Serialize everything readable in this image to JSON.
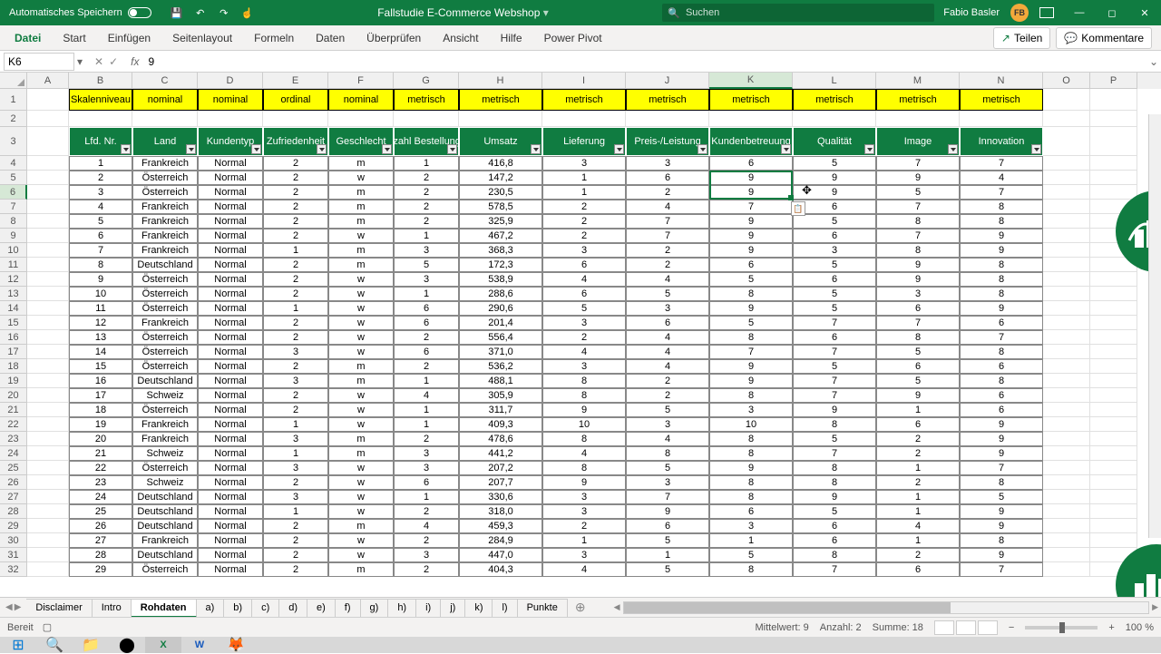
{
  "titlebar": {
    "autosave": "Automatisches Speichern",
    "filename": "Fallstudie E-Commerce Webshop",
    "search_placeholder": "Suchen",
    "username": "Fabio Basler",
    "user_initials": "FB"
  },
  "ribbon": {
    "tabs": [
      "Datei",
      "Start",
      "Einfügen",
      "Seitenlayout",
      "Formeln",
      "Daten",
      "Überprüfen",
      "Ansicht",
      "Hilfe",
      "Power Pivot"
    ],
    "share": "Teilen",
    "comments": "Kommentare"
  },
  "formula": {
    "namebox": "K6",
    "value": "9"
  },
  "columns": {
    "letters": [
      "A",
      "B",
      "C",
      "D",
      "E",
      "F",
      "G",
      "H",
      "I",
      "J",
      "K",
      "L",
      "M",
      "N",
      "O",
      "P"
    ],
    "widths": [
      46,
      70,
      72,
      72,
      72,
      72,
      72,
      92,
      92,
      92,
      92,
      92,
      92,
      92,
      52,
      52
    ],
    "selected_index": 10
  },
  "row1": {
    "label": "Skalenniveau",
    "values": [
      "nominal",
      "nominal",
      "ordinal",
      "nominal",
      "metrisch",
      "metrisch",
      "metrisch",
      "metrisch",
      "metrisch",
      "metrisch",
      "metrisch",
      "metrisch"
    ]
  },
  "table": {
    "headers": [
      "Lfd. Nr.",
      "Land",
      "Kundentyp",
      "Zufriedenheit",
      "Geschlecht",
      "Anzahl Bestellungen",
      "Umsatz",
      "Lieferung",
      "Preis-/Leistung",
      "Kundenbetreuung",
      "Qualität",
      "Image",
      "Innovation"
    ],
    "rows": [
      [
        1,
        "Frankreich",
        "Normal",
        2,
        "m",
        1,
        "416,8",
        3,
        3,
        6,
        5,
        7,
        7
      ],
      [
        2,
        "Österreich",
        "Normal",
        2,
        "w",
        2,
        "147,2",
        1,
        6,
        9,
        9,
        9,
        4
      ],
      [
        3,
        "Österreich",
        "Normal",
        2,
        "m",
        2,
        "230,5",
        1,
        2,
        9,
        9,
        5,
        7
      ],
      [
        4,
        "Frankreich",
        "Normal",
        2,
        "m",
        2,
        "578,5",
        2,
        4,
        7,
        6,
        7,
        8
      ],
      [
        5,
        "Frankreich",
        "Normal",
        2,
        "m",
        2,
        "325,9",
        2,
        7,
        9,
        5,
        8,
        8
      ],
      [
        6,
        "Frankreich",
        "Normal",
        2,
        "w",
        1,
        "467,2",
        2,
        7,
        9,
        6,
        7,
        9
      ],
      [
        7,
        "Frankreich",
        "Normal",
        1,
        "m",
        3,
        "368,3",
        3,
        2,
        9,
        3,
        8,
        9
      ],
      [
        8,
        "Deutschland",
        "Normal",
        2,
        "m",
        5,
        "172,3",
        6,
        2,
        6,
        5,
        9,
        8
      ],
      [
        9,
        "Österreich",
        "Normal",
        2,
        "w",
        3,
        "538,9",
        4,
        4,
        5,
        6,
        9,
        8
      ],
      [
        10,
        "Österreich",
        "Normal",
        2,
        "w",
        1,
        "288,6",
        6,
        5,
        8,
        5,
        3,
        8
      ],
      [
        11,
        "Österreich",
        "Normal",
        1,
        "w",
        6,
        "290,6",
        5,
        3,
        9,
        5,
        6,
        9
      ],
      [
        12,
        "Frankreich",
        "Normal",
        2,
        "w",
        6,
        "201,4",
        3,
        6,
        5,
        7,
        7,
        6
      ],
      [
        13,
        "Österreich",
        "Normal",
        2,
        "w",
        2,
        "556,4",
        2,
        4,
        8,
        6,
        8,
        7
      ],
      [
        14,
        "Österreich",
        "Normal",
        3,
        "w",
        6,
        "371,0",
        4,
        4,
        7,
        7,
        5,
        8
      ],
      [
        15,
        "Österreich",
        "Normal",
        2,
        "m",
        2,
        "536,2",
        3,
        4,
        9,
        5,
        6,
        6
      ],
      [
        16,
        "Deutschland",
        "Normal",
        3,
        "m",
        1,
        "488,1",
        8,
        2,
        9,
        7,
        5,
        8
      ],
      [
        17,
        "Schweiz",
        "Normal",
        2,
        "w",
        4,
        "305,9",
        8,
        2,
        8,
        7,
        9,
        6
      ],
      [
        18,
        "Österreich",
        "Normal",
        2,
        "w",
        1,
        "311,7",
        9,
        5,
        3,
        9,
        1,
        6
      ],
      [
        19,
        "Frankreich",
        "Normal",
        1,
        "w",
        1,
        "409,3",
        10,
        3,
        10,
        8,
        6,
        9
      ],
      [
        20,
        "Frankreich",
        "Normal",
        3,
        "m",
        2,
        "478,6",
        8,
        4,
        8,
        5,
        2,
        9
      ],
      [
        21,
        "Schweiz",
        "Normal",
        1,
        "m",
        3,
        "441,2",
        4,
        8,
        8,
        7,
        2,
        9
      ],
      [
        22,
        "Österreich",
        "Normal",
        3,
        "w",
        3,
        "207,2",
        8,
        5,
        9,
        8,
        1,
        7
      ],
      [
        23,
        "Schweiz",
        "Normal",
        2,
        "w",
        6,
        "207,7",
        9,
        3,
        8,
        8,
        2,
        8
      ],
      [
        24,
        "Deutschland",
        "Normal",
        3,
        "w",
        1,
        "330,6",
        3,
        7,
        8,
        9,
        1,
        5
      ],
      [
        25,
        "Deutschland",
        "Normal",
        1,
        "w",
        2,
        "318,0",
        3,
        9,
        6,
        5,
        1,
        9
      ],
      [
        26,
        "Deutschland",
        "Normal",
        2,
        "m",
        4,
        "459,3",
        2,
        6,
        3,
        6,
        4,
        9
      ],
      [
        27,
        "Frankreich",
        "Normal",
        2,
        "w",
        2,
        "284,9",
        1,
        5,
        1,
        6,
        1,
        8
      ],
      [
        28,
        "Deutschland",
        "Normal",
        2,
        "w",
        3,
        "447,0",
        3,
        1,
        5,
        8,
        2,
        9
      ],
      [
        29,
        "Österreich",
        "Normal",
        2,
        "m",
        2,
        "404,3",
        4,
        5,
        8,
        7,
        6,
        7
      ]
    ]
  },
  "sheet_tabs": [
    "Disclaimer",
    "Intro",
    "Rohdaten",
    "a)",
    "b)",
    "c)",
    "d)",
    "e)",
    "f)",
    "g)",
    "h)",
    "i)",
    "j)",
    "k)",
    "l)",
    "Punkte"
  ],
  "active_tab": 2,
  "status": {
    "ready": "Bereit",
    "mittelwert": "Mittelwert: 9",
    "anzahl": "Anzahl: 2",
    "summe": "Summe: 18",
    "zoom": "100 %"
  },
  "selected_row": 6
}
